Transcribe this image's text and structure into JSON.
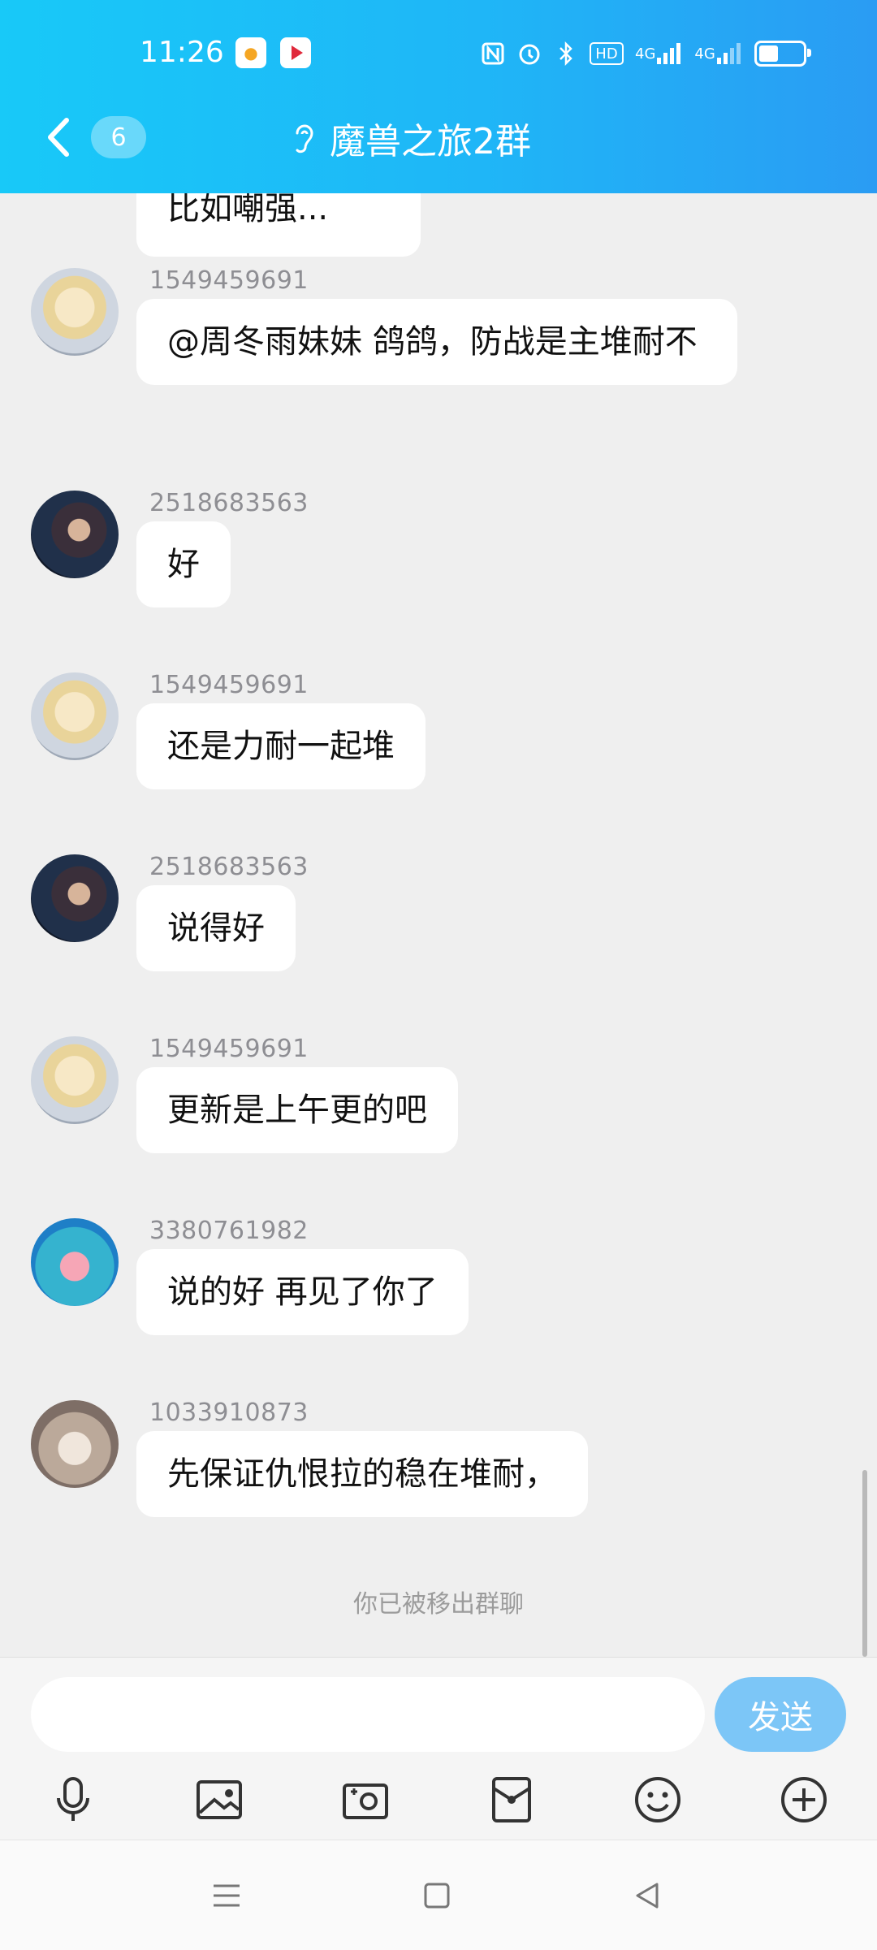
{
  "status_bar": {
    "time": "11:26",
    "icons": [
      "nfc-icon",
      "alarm-icon",
      "bluetooth-icon",
      "hd-icon",
      "signal-4g-icon",
      "signal-4g-icon",
      "battery-icon"
    ],
    "hd_label": "HD",
    "net1_label": "4G",
    "net2_label": "4G"
  },
  "header": {
    "unread_count": "6",
    "title": "魔兽之旅2群",
    "background_colors": [
      "#18c9f8",
      "#2a9cf3"
    ]
  },
  "messages": [
    {
      "sender": "",
      "text": "比如嘲强..."
    },
    {
      "sender": "1549459691",
      "text": "@周冬雨妹妹 鸽鸽，防战是主堆耐不"
    },
    {
      "sender": "2518683563",
      "text": "好"
    },
    {
      "sender": "1549459691",
      "text": "还是力耐一起堆"
    },
    {
      "sender": "2518683563",
      "text": "说得好"
    },
    {
      "sender": "1549459691",
      "text": "更新是上午更的吧"
    },
    {
      "sender": "3380761982",
      "text": "说的好 再见了你了"
    },
    {
      "sender": "1033910873",
      "text": "先保证仇恨拉的稳在堆耐，"
    }
  ],
  "system_note": "你已被移出群聊",
  "input": {
    "placeholder": "",
    "value": "",
    "send_label": "发送",
    "send_color": "#7cc6f7"
  },
  "toolbar": [
    "microphone-icon",
    "image-icon",
    "camera-icon",
    "red-packet-icon",
    "emoji-icon",
    "plus-icon"
  ]
}
